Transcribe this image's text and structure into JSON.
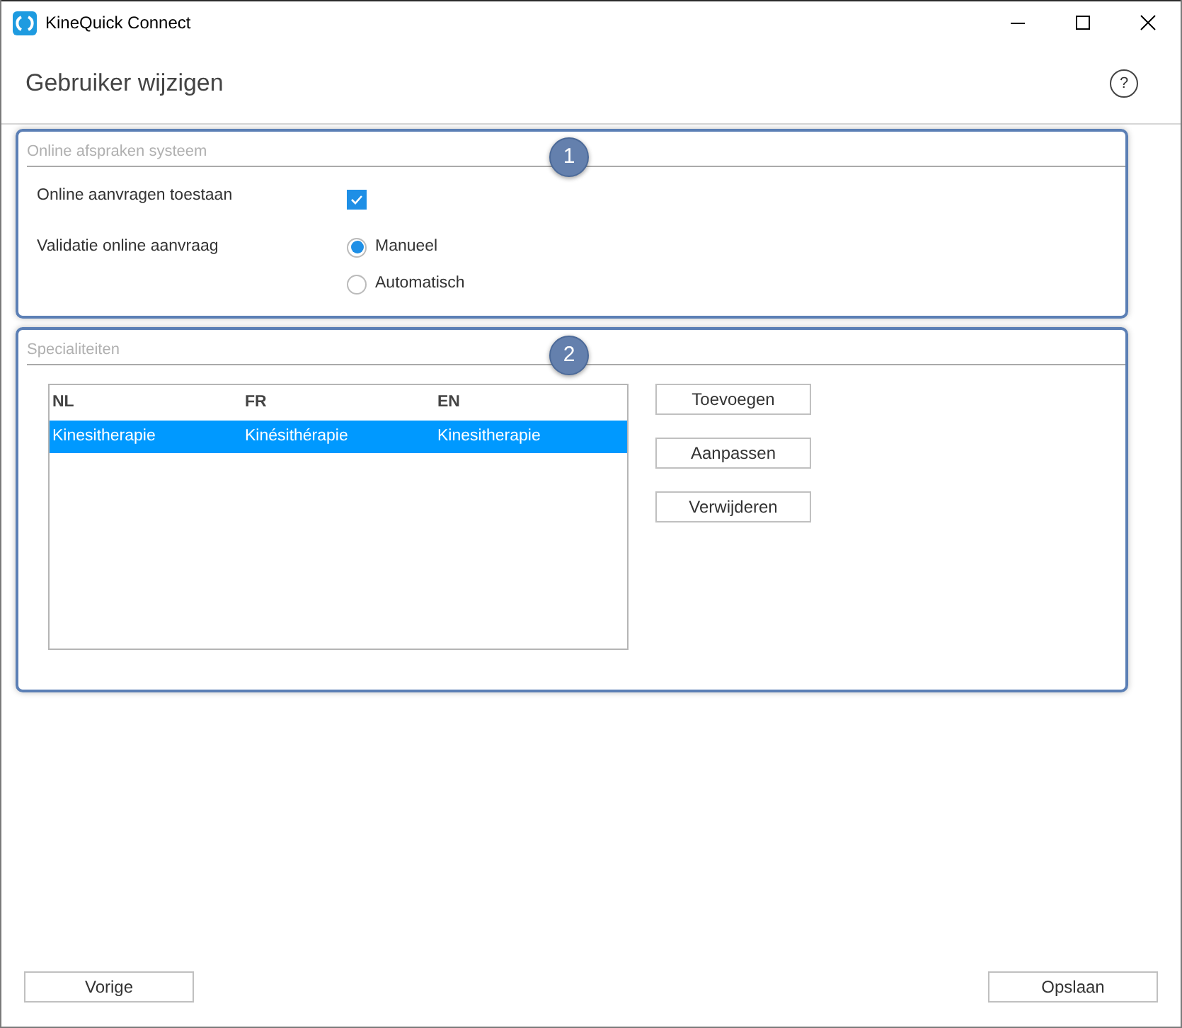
{
  "window": {
    "title": "KineQuick Connect"
  },
  "header": {
    "title": "Gebruiker wijzigen",
    "help": "?"
  },
  "sections": [
    {
      "title": "Online afspraken systeem",
      "badge": "1",
      "kind": "settings",
      "checkbox": {
        "label": "Online aanvragen toestaan",
        "checked": true
      },
      "radio_group": {
        "label": "Validatie online aanvraag",
        "options": [
          {
            "label": "Manueel",
            "selected": true
          },
          {
            "label": "Automatisch",
            "selected": false
          }
        ]
      }
    },
    {
      "title": "Specialiteiten",
      "badge": "2",
      "kind": "table",
      "table": {
        "columns": [
          "NL",
          "FR",
          "EN"
        ],
        "rows": [
          {
            "cells": [
              "Kinesitherapie",
              "Kinésithérapie",
              "Kinesitherapie"
            ],
            "selected": true
          }
        ]
      },
      "buttons": [
        "Toevoegen",
        "Aanpassen",
        "Verwijderen"
      ]
    }
  ],
  "footer": {
    "back": "Vorige",
    "save": "Opslaan"
  }
}
